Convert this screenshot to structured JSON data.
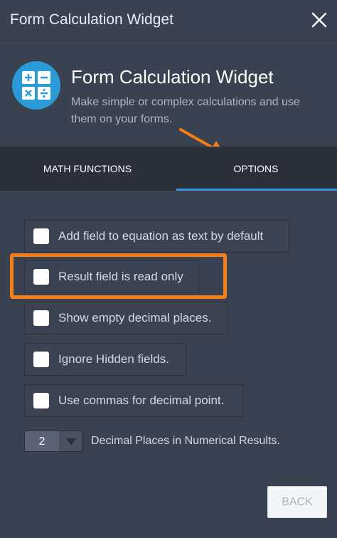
{
  "window": {
    "title": "Form Calculation Widget"
  },
  "header": {
    "icon": "calculator-icon",
    "title": "Form Calculation Widget",
    "description": "Make simple or complex calculations and use them on your forms."
  },
  "tabs": [
    {
      "label": "MATH FUNCTIONS",
      "active": false
    },
    {
      "label": "OPTIONS",
      "active": true
    }
  ],
  "options": [
    {
      "label": "Add field to equation as text by default",
      "checked": false
    },
    {
      "label": "Result field is read only",
      "checked": false,
      "highlighted": true
    },
    {
      "label": "Show empty decimal places.",
      "checked": false
    },
    {
      "label": "Ignore Hidden fields.",
      "checked": false
    },
    {
      "label": "Use commas for decimal point.",
      "checked": false
    }
  ],
  "decimal_places": {
    "value": "2",
    "label": "Decimal Places in Numerical Results."
  },
  "footer": {
    "back_label": "BACK"
  },
  "colors": {
    "accent": "#2a9bd8",
    "highlight": "#f57f17",
    "background": "#3a4150",
    "tab_bar": "#2b303b"
  }
}
